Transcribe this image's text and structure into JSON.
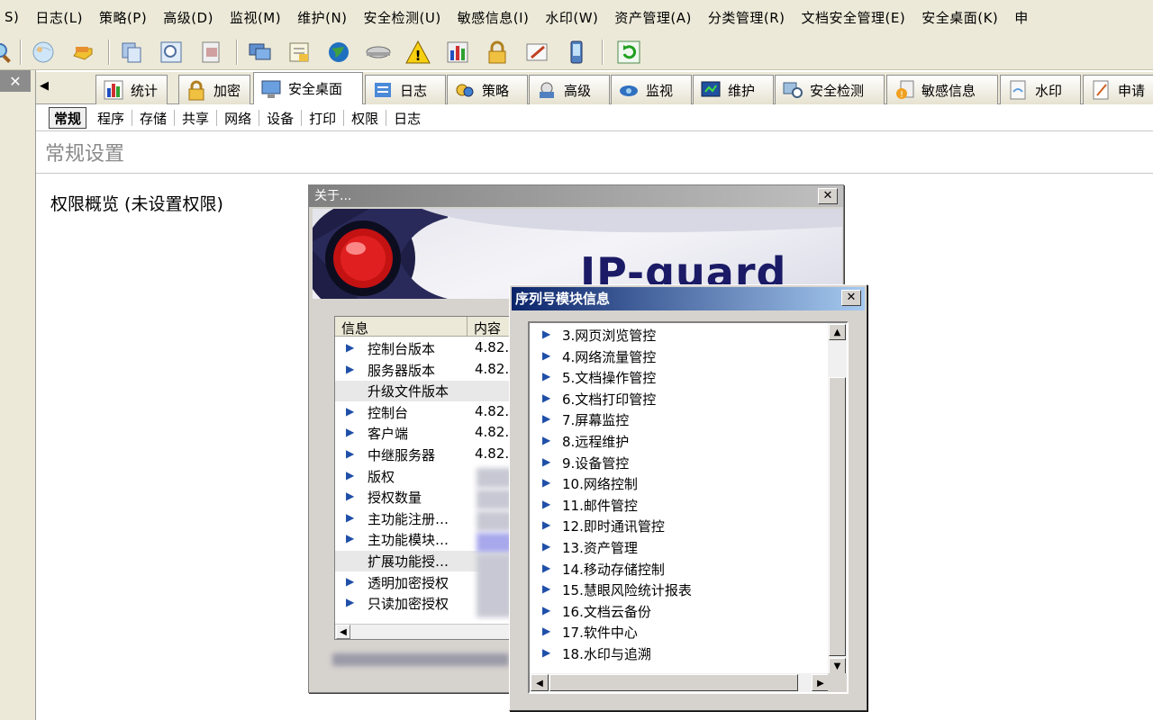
{
  "menubar": {
    "items": [
      "S)",
      "日志(L)",
      "策略(P)",
      "高级(D)",
      "监视(M)",
      "维护(N)",
      "安全检测(U)",
      "敏感信息(I)",
      "水印(W)",
      "资产管理(A)",
      "分类管理(R)",
      "文档安全管理(E)",
      "安全桌面(K)",
      "申"
    ]
  },
  "toolbar": {
    "icons": [
      "search-icon",
      "globe-icon",
      "hand-icon",
      "copy-icon",
      "zoom-icon",
      "document-icon",
      "computers-icon",
      "list-icon",
      "network-globe-icon",
      "disk-icon",
      "warning-icon",
      "chart-icon",
      "lock-icon",
      "edit-icon",
      "mobile-icon",
      "refresh-icon"
    ]
  },
  "left_pane": {
    "close": "✕"
  },
  "module_tabs": {
    "scroll_left": "◀",
    "tabs": [
      {
        "label": "统计",
        "icon": "chart-icon"
      },
      {
        "label": "加密",
        "icon": "lock-icon"
      },
      {
        "label": "安全桌面",
        "icon": "desktop-icon"
      },
      {
        "label": "日志",
        "icon": "log-icon"
      },
      {
        "label": "策略",
        "icon": "policy-icon"
      },
      {
        "label": "高级",
        "icon": "advanced-icon"
      },
      {
        "label": "监视",
        "icon": "monitor-icon"
      },
      {
        "label": "维护",
        "icon": "maintenance-icon"
      },
      {
        "label": "安全检测",
        "icon": "security-check-icon"
      },
      {
        "label": "敏感信息",
        "icon": "sensitive-info-icon"
      },
      {
        "label": "水印",
        "icon": "watermark-icon"
      },
      {
        "label": "申请",
        "icon": "request-icon"
      }
    ],
    "active": "安全桌面"
  },
  "sub_tabs": {
    "tabs": [
      "常规",
      "程序",
      "存储",
      "共享",
      "网络",
      "设备",
      "打印",
      "权限",
      "日志"
    ],
    "active": "常规"
  },
  "section": {
    "title": "常规设置",
    "permission_label": "权限概览 (未设置权限)"
  },
  "about_dialog": {
    "title": "关于...",
    "close": "✕",
    "brand": "IP-guard",
    "columns": [
      "信息",
      "内容"
    ],
    "rows": [
      {
        "name": "控制台版本",
        "value": "4.82.",
        "group": false
      },
      {
        "name": "服务器版本",
        "value": "4.82.",
        "group": false
      },
      {
        "name": "升级文件版本",
        "value": "",
        "group": true
      },
      {
        "name": "控制台",
        "value": "4.82.",
        "group": false
      },
      {
        "name": "客户端",
        "value": "4.82.",
        "group": false
      },
      {
        "name": "中继服务器",
        "value": "4.82.",
        "group": false
      },
      {
        "name": "版权",
        "value": "",
        "group": false
      },
      {
        "name": "授权数量",
        "value": "",
        "group": false
      },
      {
        "name": "主功能注册…",
        "value": "",
        "group": false
      },
      {
        "name": "主功能模块…",
        "value": "",
        "group": false
      },
      {
        "name": "扩展功能授…",
        "value": "",
        "group": true
      },
      {
        "name": "透明加密授权",
        "value": "",
        "group": false
      },
      {
        "name": "只读加密授权",
        "value": "",
        "group": false
      }
    ],
    "scroll_left": "◀"
  },
  "serial_dialog": {
    "title": "序列号模块信息",
    "close": "✕",
    "items": [
      "3.网页浏览管控",
      "4.网络流量管控",
      "5.文档操作管控",
      "6.文档打印管控",
      "7.屏幕监控",
      "8.远程维护",
      "9.设备管控",
      "10.网络控制",
      "11.邮件管控",
      "12.即时通讯管控",
      "13.资产管理",
      "14.移动存储控制",
      "15.慧眼风险统计报表",
      "16.文档云备份",
      "17.软件中心",
      "18.水印与追溯"
    ],
    "scroll_up": "▲",
    "scroll_down": "▼",
    "scroll_left": "◀",
    "scroll_right": "▶"
  },
  "colors": {
    "chrome": "#ece9d8",
    "dialog_face": "#d6d3ce",
    "serial_title_start": "#0a246a",
    "serial_title_end": "#a6caf0",
    "brand_text": "#1a1a66",
    "tree_arrow": "#1f4fa8",
    "section_title": "#8a8a8a"
  }
}
